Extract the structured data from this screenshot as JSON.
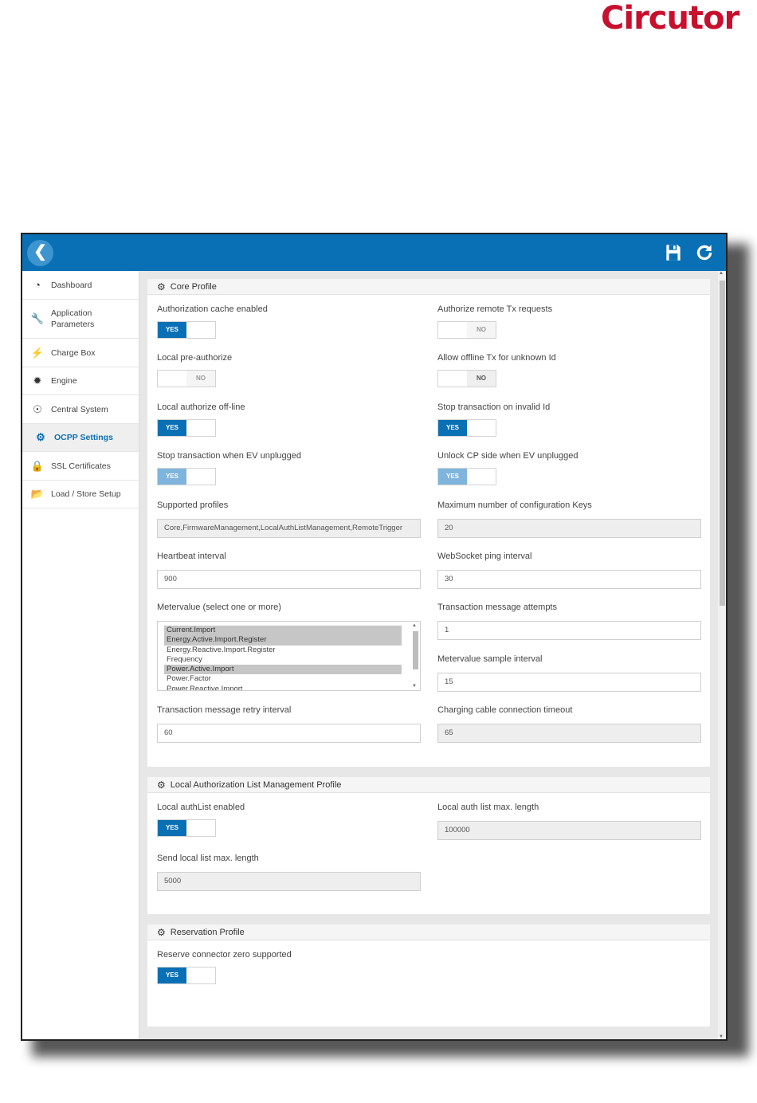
{
  "brand": "Circutor",
  "topbar": {
    "back_icon": "chevron-left-icon",
    "save_icon": "floppy-disk-icon",
    "refresh_icon": "refresh-icon"
  },
  "sidebar": {
    "items": [
      {
        "label": "Dashboard",
        "icon": "dashboard-icon"
      },
      {
        "label": "Application\nParameters",
        "icon": "wrench-icon"
      },
      {
        "label": "Charge Box",
        "icon": "bolt-icon"
      },
      {
        "label": "Engine",
        "icon": "cog-icon"
      },
      {
        "label": "Central System",
        "icon": "target-icon"
      },
      {
        "label": "OCPP Settings",
        "icon": "gear-icon",
        "active": true
      },
      {
        "label": "SSL Certificates",
        "icon": "lock-icon"
      },
      {
        "label": "Load / Store Setup",
        "icon": "folder-open-icon"
      }
    ]
  },
  "core": {
    "title": "Core Profile",
    "auth_cache": {
      "label": "Authorization cache enabled",
      "value": "YES"
    },
    "remote_tx": {
      "label": "Authorize remote Tx requests",
      "value": "NO"
    },
    "local_pre": {
      "label": "Local pre-authorize",
      "value": "NO"
    },
    "offline_tx": {
      "label": "Allow offline Tx for unknown Id",
      "value": "NO"
    },
    "local_offline": {
      "label": "Local authorize off-line",
      "value": "YES"
    },
    "stop_invalid": {
      "label": "Stop transaction on invalid Id",
      "value": "YES"
    },
    "stop_unplug": {
      "label": "Stop transaction when EV unplugged",
      "value": "YES"
    },
    "unlock_cp": {
      "label": "Unlock CP side when EV unplugged",
      "value": "YES"
    },
    "profiles": {
      "label": "Supported profiles",
      "value": "Core,FirmwareManagement,LocalAuthListManagement,RemoteTrigger"
    },
    "max_keys": {
      "label": "Maximum number of configuration Keys",
      "value": "20"
    },
    "heartbeat": {
      "label": "Heartbeat interval",
      "value": "900"
    },
    "ws_ping": {
      "label": "WebSocket ping interval",
      "value": "30"
    },
    "metervalue": {
      "label": "Metervalue (select one or more)",
      "options": [
        {
          "text": "Current.Import",
          "selected": true
        },
        {
          "text": "Energy.Active.Import.Register",
          "selected": true
        },
        {
          "text": "Energy.Reactive.Import.Register",
          "selected": false
        },
        {
          "text": "Frequency",
          "selected": false
        },
        {
          "text": "Power.Active.Import",
          "selected": true
        },
        {
          "text": "Power.Factor",
          "selected": false
        },
        {
          "text": "Power.Reactive.Import",
          "selected": false
        }
      ]
    },
    "tx_attempts": {
      "label": "Transaction message attempts",
      "value": "1"
    },
    "mv_sample": {
      "label": "Metervalue sample interval",
      "value": "15"
    },
    "tx_retry": {
      "label": "Transaction message retry interval",
      "value": "60"
    },
    "cable_timeout": {
      "label": "Charging cable connection timeout",
      "value": "65"
    }
  },
  "localauth": {
    "title": "Local Authorization List Management Profile",
    "enabled": {
      "label": "Local authList enabled",
      "value": "YES"
    },
    "max_len": {
      "label": "Local auth list max. length",
      "value": "100000"
    },
    "send_max": {
      "label": "Send local list max. length",
      "value": "5000"
    }
  },
  "reservation": {
    "title": "Reservation Profile",
    "zero": {
      "label": "Reserve connector zero supported",
      "value": "YES"
    }
  }
}
